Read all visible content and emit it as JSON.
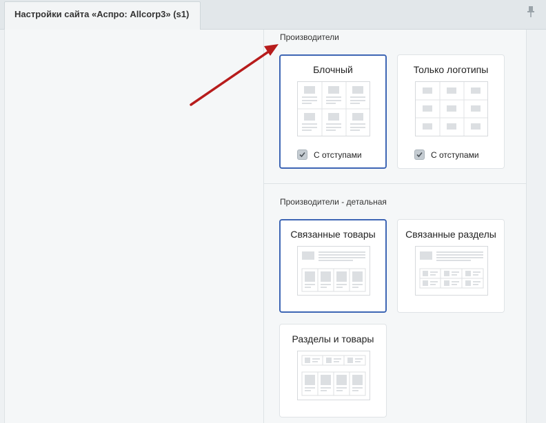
{
  "header": {
    "tab_title": "Настройки сайта «Аспро: Allcorp3» (s1)",
    "pin_icon": "pin-icon"
  },
  "section_manufacturers": {
    "title": "Производители",
    "options": [
      {
        "label": "Блочный",
        "selected": true,
        "checkbox_label": "С отступами",
        "checked": true
      },
      {
        "label": "Только логотипы",
        "selected": false,
        "checkbox_label": "С отступами",
        "checked": true
      }
    ]
  },
  "section_manufacturers_detail": {
    "title": "Производители - детальная",
    "options": [
      {
        "label": "Связанные товары",
        "selected": true
      },
      {
        "label": "Связанные разделы",
        "selected": false
      },
      {
        "label": "Разделы и товары",
        "selected": false
      }
    ]
  },
  "colors": {
    "accent": "#3d65b4",
    "arrow": "#b71c1c"
  }
}
